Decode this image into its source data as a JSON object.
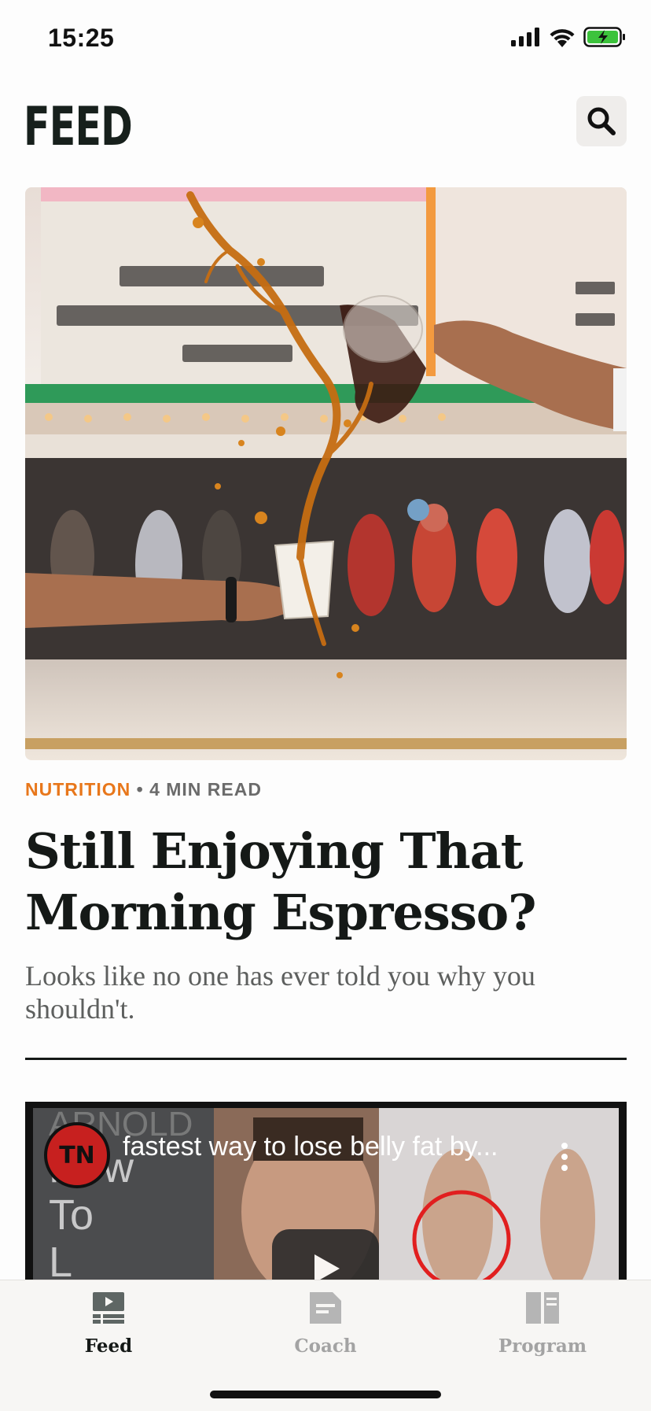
{
  "status_bar": {
    "time": "15:25"
  },
  "header": {
    "title": "FEED"
  },
  "article": {
    "category": "NUTRITION",
    "separator": "•",
    "read_time": "4 MIN READ",
    "title": "Still Enjoying That Morning Espresso?",
    "subtitle": "Looks like no one has ever told you why you shouldn't."
  },
  "video": {
    "channel_badge": "TN",
    "title": "fastest way to lose belly fat by...",
    "thumb_lines": [
      "ARNOLD",
      "How",
      "To",
      "L"
    ]
  },
  "tabs": [
    {
      "label": "Feed",
      "icon": "feed-icon",
      "active": true
    },
    {
      "label": "Coach",
      "icon": "coach-icon",
      "active": false
    },
    {
      "label": "Program",
      "icon": "program-icon",
      "active": false
    }
  ],
  "colors": {
    "accent": "#e8771b",
    "text_dark": "#151917",
    "tab_inactive": "#a3a3a3",
    "battery_green": "#3cc33c"
  }
}
